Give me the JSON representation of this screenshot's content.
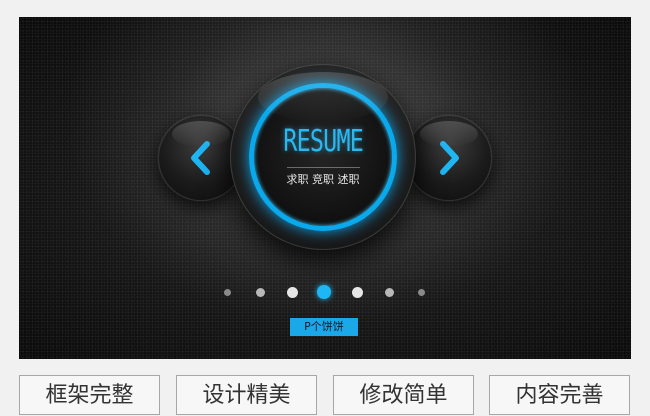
{
  "banner": {
    "title": "RESUME",
    "subtitle": "求职 竞职 述职",
    "tag": "P个饼饼",
    "accent_color": "#1fb6f4",
    "prev_icon": "chevron-left-icon",
    "next_icon": "chevron-right-icon",
    "carousel": {
      "dot_count": 7,
      "active_index": 3
    }
  },
  "features": [
    {
      "label": "框架完整"
    },
    {
      "label": "设计精美"
    },
    {
      "label": "修改简单"
    },
    {
      "label": "内容完善"
    }
  ]
}
